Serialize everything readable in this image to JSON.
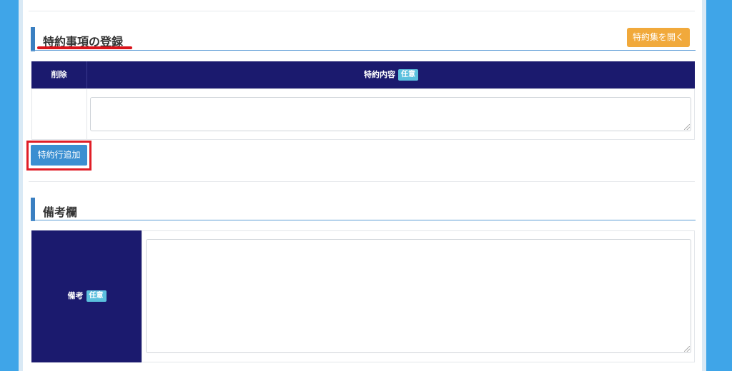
{
  "special_terms": {
    "title": "特約事項の登録",
    "open_button": "特約集を開く",
    "table": {
      "col_delete": "削除",
      "col_content": "特約内容",
      "badge": "任意"
    },
    "add_row_button": "特約行追加"
  },
  "remarks": {
    "title": "備考欄",
    "label": "備考",
    "badge": "任意"
  },
  "colors": {
    "header_bg": "#1b1a6e",
    "accent": "#3a7fc1",
    "orange_button": "#f1a93b",
    "badge": "#5bc0de",
    "highlight_red": "#e01e27",
    "page_bg": "#3fa5e8"
  }
}
